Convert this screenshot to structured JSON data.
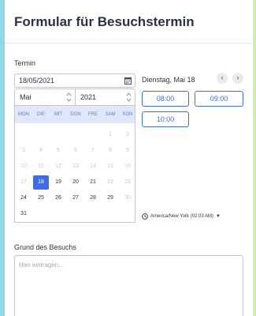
{
  "form": {
    "title": "Formular für Besuchstermin",
    "termin_label": "Termin",
    "date_value": "18/05/2021",
    "month": "Mai",
    "year": "2021",
    "weekdays": [
      "MON",
      "DIE",
      "MIT",
      "DON",
      "FRE",
      "SAM",
      "SON"
    ],
    "weeks": [
      [
        "",
        "",
        "",
        "",
        "",
        "1",
        "2"
      ],
      [
        "3",
        "4",
        "5",
        "6",
        "7",
        "8",
        "9"
      ],
      [
        "10",
        "11",
        "12",
        "13",
        "14",
        "15",
        "16"
      ],
      [
        "17",
        "18",
        "19",
        "20",
        "21",
        "22",
        "23"
      ],
      [
        "24",
        "25",
        "26",
        "27",
        "28",
        "29",
        "30"
      ],
      [
        "31",
        "",
        "",
        "",
        "",
        "",
        ""
      ]
    ],
    "selected_day": "18",
    "disabled_days": [
      "1",
      "2",
      "3",
      "4",
      "5",
      "6",
      "7",
      "8",
      "9",
      "10",
      "11",
      "12",
      "13",
      "14",
      "15",
      "16",
      "17",
      "22",
      "23",
      "30"
    ],
    "selected_date_heading": "Dienstag, Mai 18",
    "time_slots": [
      "08:00",
      "09:00",
      "10:00"
    ],
    "timezone": "America/New York (02:03 AM)",
    "reason_label": "Grund des Besuchs",
    "reason_placeholder": "Hier eintragen..."
  },
  "colors": {
    "accent": "#3d6ee6",
    "weekday_header_bg": "#dfe8fb",
    "text": "#2b3245",
    "disabled_text": "#c5c8d0"
  },
  "icons": {
    "date_input": "calendar-icon",
    "prev": "chevron-left-icon",
    "next": "chevron-right-icon",
    "timezone": "clock-icon",
    "timezone_dropdown": "caret-down-icon",
    "spinner": "spinner-arrows-icon"
  }
}
